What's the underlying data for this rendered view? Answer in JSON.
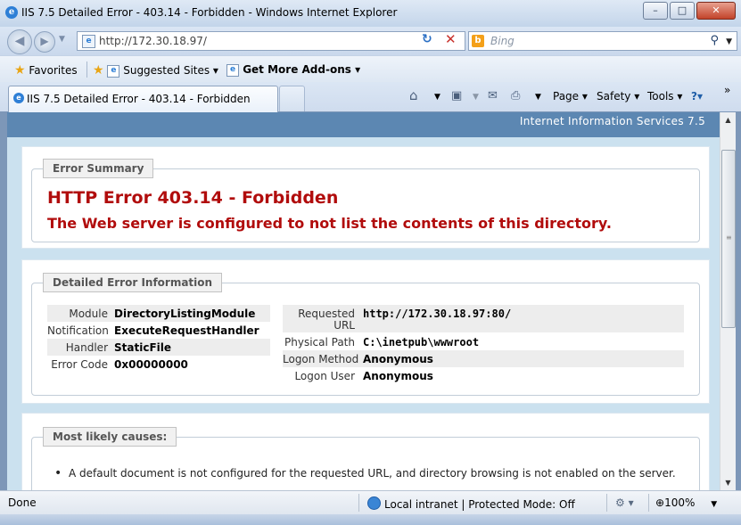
{
  "window": {
    "title": "IIS 7.5 Detailed Error - 403.14 - Forbidden - Windows Internet Explorer",
    "minimize": "–",
    "maximize": "□",
    "close": "✕"
  },
  "address_bar": {
    "url": "http://172.30.18.97/",
    "search_placeholder": "Bing",
    "search_engine_icon": "b"
  },
  "favorites_bar": {
    "favorites_label": "Favorites",
    "suggested_sites_label": "Suggested Sites ▾",
    "addons_label": "Get More Add-ons ▾"
  },
  "tab": {
    "label": "IIS 7.5 Detailed Error - 403.14 - Forbidden"
  },
  "command_bar": {
    "page_label": "Page ▾",
    "safety_label": "Safety ▾",
    "tools_label": "Tools ▾",
    "help_label": "?▾",
    "more": "»"
  },
  "page": {
    "header": "Internet Information Services 7.5",
    "error_summary": {
      "legend": "Error Summary",
      "title": "HTTP Error 403.14 - Forbidden",
      "subtitle": "The Web server is configured to not list the contents of this directory."
    },
    "detailed_info": {
      "legend": "Detailed Error Information",
      "left": [
        {
          "label": "Module",
          "value": "DirectoryListingModule"
        },
        {
          "label": "Notification",
          "value": "ExecuteRequestHandler"
        },
        {
          "label": "Handler",
          "value": "StaticFile"
        },
        {
          "label": "Error Code",
          "value": "0x00000000"
        }
      ],
      "right": [
        {
          "label": "Requested",
          "label2": "URL",
          "value": "http://172.30.18.97:80/"
        },
        {
          "label": "Physical Path",
          "value": "C:\\inetpub\\wwwroot"
        },
        {
          "label": "Logon Method",
          "value": "Anonymous"
        },
        {
          "label": "Logon User",
          "value": "Anonymous"
        }
      ]
    },
    "causes": {
      "legend": "Most likely causes:",
      "items": [
        "A default document is not configured for the requested URL, and directory browsing is not enabled on the server."
      ]
    }
  },
  "status_bar": {
    "status": "Done",
    "zone": "Local intranet | Protected Mode: Off",
    "zoom": "100%"
  }
}
